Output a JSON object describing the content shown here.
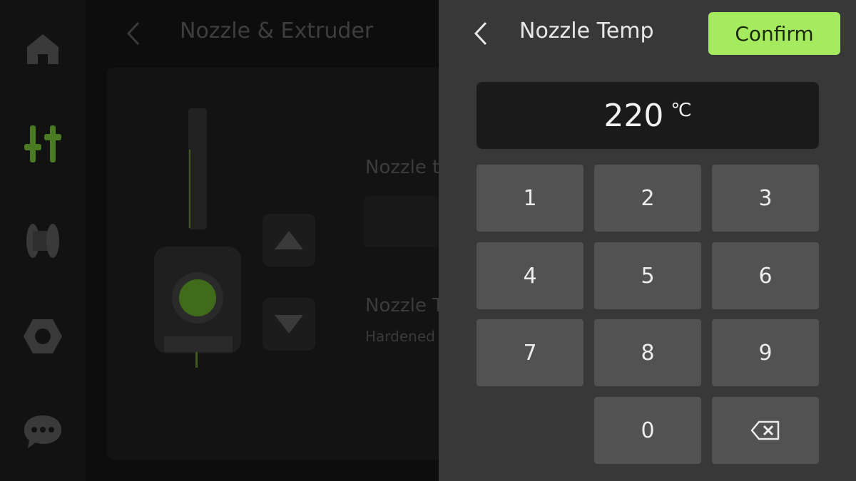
{
  "background_screen": {
    "title": "Nozzle & Extruder",
    "nozzle_temp_label": "Nozzle t",
    "nozzle_type_label": "Nozzle T",
    "nozzle_type_value": "Hardened",
    "sidebar": {
      "items": [
        {
          "icon": "home-icon",
          "active": false
        },
        {
          "icon": "controls-icon",
          "active": true
        },
        {
          "icon": "filament-spool-icon",
          "active": false
        },
        {
          "icon": "nut-icon",
          "active": false
        },
        {
          "icon": "message-icon",
          "active": false
        }
      ]
    }
  },
  "keypad_panel": {
    "title": "Nozzle Temp",
    "confirm_label": "Confirm",
    "value": "220",
    "unit": "℃",
    "keys": [
      "1",
      "2",
      "3",
      "4",
      "5",
      "6",
      "7",
      "8",
      "9",
      "0"
    ],
    "backspace_icon": "backspace-icon"
  },
  "colors": {
    "accent": "#a6ea5f",
    "panel_bg": "#383838",
    "key_bg": "#525252",
    "display_bg": "#1a1a1a"
  }
}
